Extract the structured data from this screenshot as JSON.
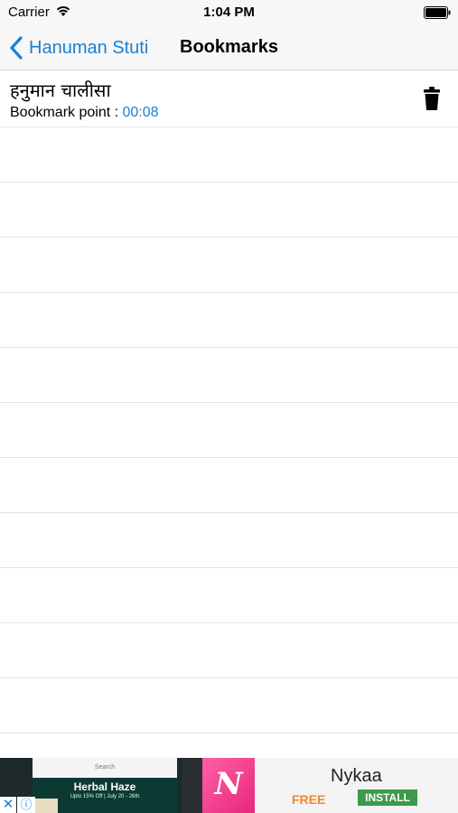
{
  "status_bar": {
    "carrier": "Carrier",
    "time": "1:04 PM"
  },
  "nav": {
    "back_label": "Hanuman Stuti",
    "title": "Bookmarks"
  },
  "bookmarks": [
    {
      "name": "हनुमान चालीसा",
      "point_label": "Bookmark point : ",
      "point_value": "00:08"
    }
  ],
  "ad": {
    "search_text": "Search",
    "headline": "Herbal Haze",
    "subtext": "Upto 15% Off | July 20 - 26th",
    "logo_letter": "N",
    "app_name": "Nykaa",
    "price": "FREE",
    "install_label": "INSTALL",
    "close_glyph": "✕",
    "info_glyph": "ⓘ"
  },
  "colors": {
    "accent": "#1b7fd6",
    "install": "#3c9a4a",
    "free": "#f08a2a"
  },
  "icons": {
    "back": "chevron-left-icon",
    "delete": "trash-icon",
    "wifi": "wifi-icon",
    "battery": "battery-icon"
  }
}
